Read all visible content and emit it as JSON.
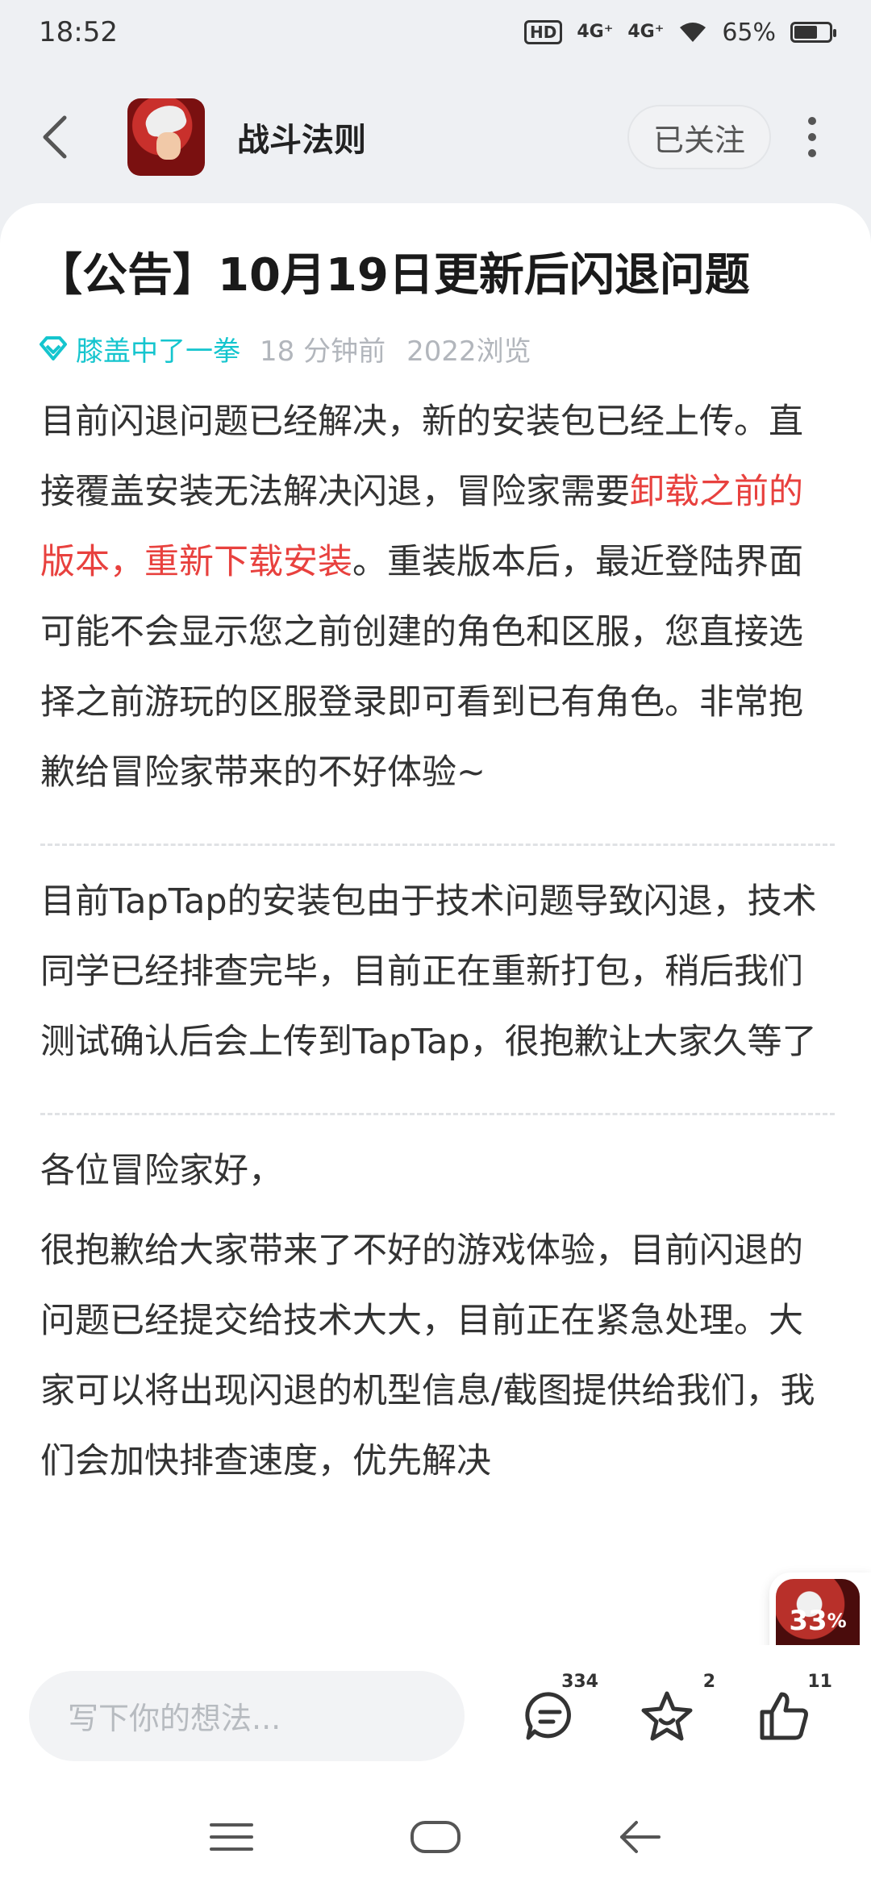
{
  "status_bar": {
    "time": "18:52",
    "hd_label": "HD",
    "signal1": "4G⁺",
    "signal2": "4G⁺",
    "battery_percent": "65%",
    "battery_level": 0.65
  },
  "header": {
    "app_name": "战斗法则",
    "follow_label": "已关注"
  },
  "post": {
    "title": "【公告】10月19日更新后闪退问题",
    "author": "膝盖中了一拳",
    "time_ago": "18 分钟前",
    "views": "2022浏览",
    "para1_a": "目前闪退问题已经解决，新的安装包已经上传。直接覆盖安装无法解决闪退，冒险家需要",
    "para1_red": "卸载之前的版本，重新下载安装",
    "para1_b": "。重装版本后，最近登陆界面可能不会显示您之前创建的角色和区服，您直接选择之前游玩的区服登录即可看到已有角色。非常抱歉给冒险家带来的不好体验~",
    "para2": "目前TapTap的安装包由于技术问题导致闪退，技术同学已经排查完毕，目前正在重新打包，稍后我们测试确认后会上传到TapTap，很抱歉让大家久等了",
    "para3": "各位冒险家好，",
    "para4": "很抱歉给大家带来了不好的游戏体验，目前闪退的问题已经提交给技术大大，目前正在紧急处理。大家可以将出现闪退的机型信息/截图提供给我们，我们会加快排查速度，优先解决"
  },
  "float_thumb": {
    "percent": "33",
    "percent_sign": "%"
  },
  "bottom_bar": {
    "input_placeholder": "写下你的想法...",
    "comment_count": "334",
    "favorite_count": "2",
    "like_count": "11"
  },
  "colors": {
    "accent": "#15c5ce",
    "highlight_red": "#e8413e"
  }
}
